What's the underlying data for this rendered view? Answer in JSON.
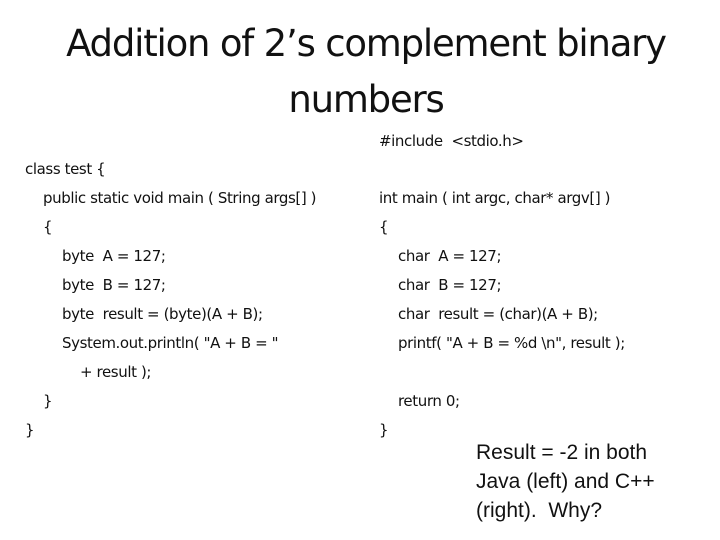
{
  "slide": {
    "title_lines": [
      "Addition of 2’s complement binary",
      "numbers"
    ],
    "java_code": {
      "language": "Java",
      "lines": [
        "class test {",
        "public static void main ( String args[] )",
        "{",
        "byte  A = 127;",
        "byte  B = 127;",
        "byte  result = (byte)(A + B);",
        "System.out.println( \"A + B = \"",
        "+ result );",
        "}",
        "}"
      ]
    },
    "c_code": {
      "language": "C++",
      "lines": [
        "#include  <stdio.h>",
        "int main ( int argc, char* argv[] )",
        "{",
        "char  A = 127;",
        "char  B = 127;",
        "char  result = (char)(A + B);",
        "printf( \"A + B = %d \\n\", result );",
        "return 0;",
        "}"
      ]
    },
    "note_lines": [
      "Result = -2 in both",
      "Java (left) and C++",
      "(right).  Why?"
    ]
  }
}
